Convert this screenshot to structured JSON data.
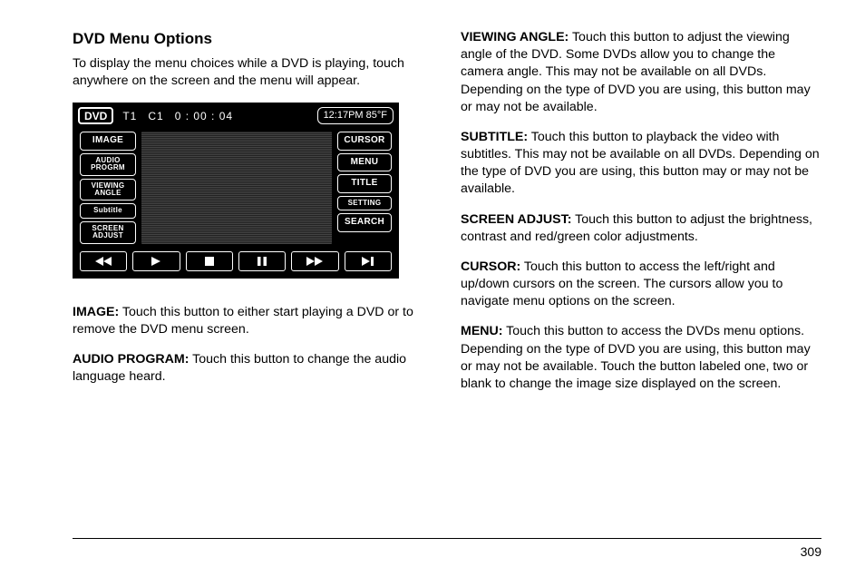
{
  "heading": "DVD Menu Options",
  "intro": "To display the menu choices while a DVD is playing, touch anywhere on the screen and the menu will appear.",
  "dvd_screen": {
    "badge": "DVD",
    "track": "T1",
    "chapter": "C1",
    "elapsed": "0 : 00 : 04",
    "clock": "12:17PM  85°F",
    "left_buttons": [
      "IMAGE",
      "AUDIO\nPROGRM",
      "VIEWING\nANGLE",
      "Subtitle",
      "SCREEN\nADJUST"
    ],
    "right_buttons": [
      "CURSOR",
      "MENU",
      "TITLE",
      "SETTING",
      "SEARCH"
    ],
    "transport_icons": [
      "rewind",
      "play",
      "stop",
      "pause",
      "ffwd",
      "next"
    ]
  },
  "definitions": [
    {
      "term": "IMAGE:",
      "body": "  Touch this button to either start playing a DVD or to remove the DVD menu screen."
    },
    {
      "term": "AUDIO PROGRAM:",
      "body": "  Touch this button to change the audio language heard."
    },
    {
      "term": "VIEWING ANGLE:",
      "body": "  Touch this button to adjust the viewing angle of the DVD. Some DVDs allow you to change the camera angle. This may not be available on all DVDs. Depending on the type of DVD you are using, this button may or may not be available."
    },
    {
      "term": "SUBTITLE:",
      "body": "  Touch this button to playback the video with subtitles. This may not be available on all DVDs. Depending on the type of DVD you are using, this button may or may not be available."
    },
    {
      "term": "SCREEN ADJUST:",
      "body": "  Touch this button to adjust the brightness, contrast and red/green color adjustments."
    },
    {
      "term": "CURSOR:",
      "body": "  Touch this button to access the left/right and up/down cursors on the screen. The cursors allow you to navigate menu options on the screen."
    },
    {
      "term": "MENU:",
      "body": "  Touch this button to access the DVDs menu options. Depending on the type of DVD you are using, this button may or may not be available. Touch the button labeled one, two or blank to change the image size displayed on the screen."
    }
  ],
  "page_number": "309"
}
